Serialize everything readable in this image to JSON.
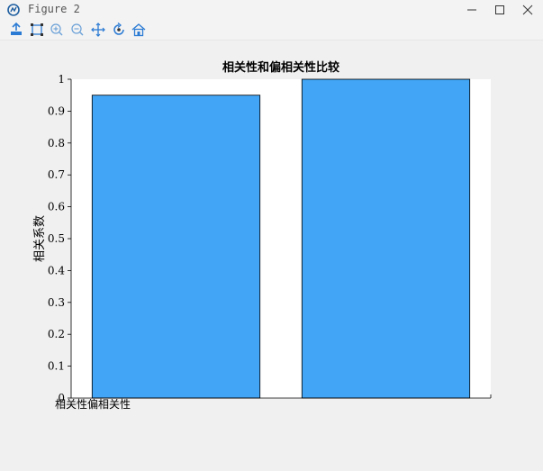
{
  "window": {
    "title": "Figure 2"
  },
  "icons": {
    "app": "matplotlib-icon",
    "minimize": "minimize-icon",
    "maximize": "maximize-icon",
    "close": "close-icon"
  },
  "toolbar": {
    "items": [
      "save-icon",
      "subplots-icon",
      "zoom-in-icon",
      "zoom-out-icon",
      "pan-icon",
      "rotate-icon",
      "home-icon"
    ]
  },
  "colors": {
    "bar": "#42a5f5",
    "bar_edge": "#000000"
  },
  "chart_data": {
    "type": "bar",
    "title": "相关性和偏相关性比较",
    "ylabel": "相关系数",
    "xlabel": "",
    "tick_label_text": "相关性偏相关性",
    "categories": [
      "相关性",
      "偏相关性"
    ],
    "values": [
      0.95,
      1.0
    ],
    "ylim": [
      0,
      1
    ],
    "yticks": [
      "0",
      "0.1",
      "0.2",
      "0.3",
      "0.4",
      "0.5",
      "0.6",
      "0.7",
      "0.8",
      "0.9",
      "1"
    ],
    "grid": false
  }
}
